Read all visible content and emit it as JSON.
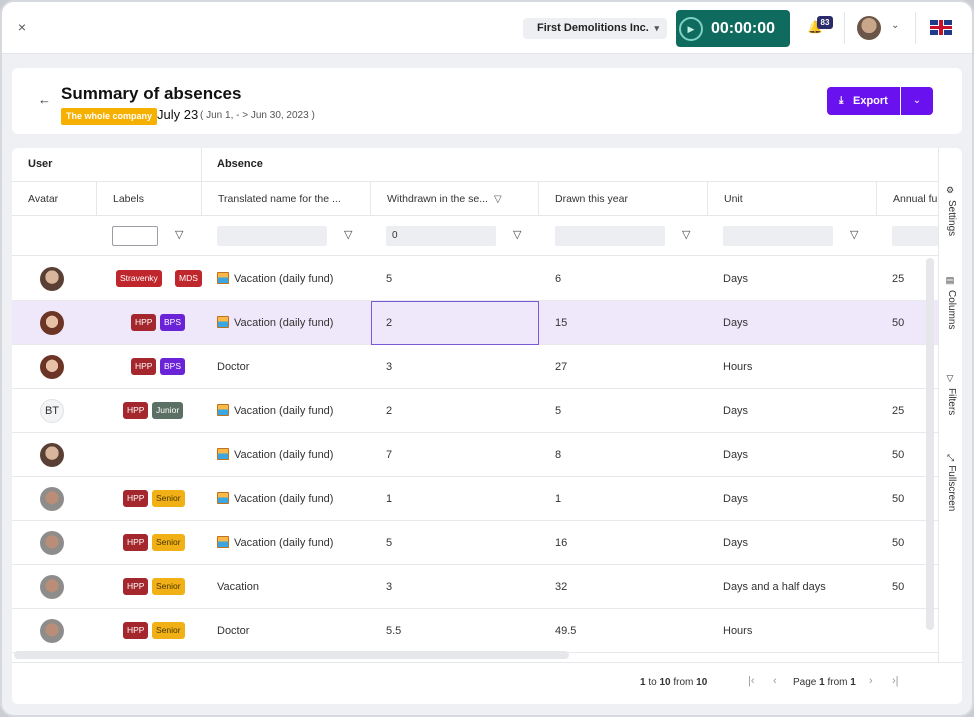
{
  "topbar": {
    "close_icon": "×",
    "company": "First Demolitions Inc.",
    "timer": "00:00:00",
    "notifications_count": "83"
  },
  "header": {
    "title": "Summary of absences",
    "scope_badge": "The whole company",
    "period": "July 23",
    "period_range": "( Jun 1, - > Jun 30, 2023 )",
    "export_label": "Export"
  },
  "table": {
    "group_user": "User",
    "group_absence": "Absence",
    "columns": {
      "avatar": "Avatar",
      "labels": "Labels",
      "name": "Translated name for the ...",
      "withdrawn": "Withdrawn in the se...",
      "drawn": "Drawn this year",
      "unit": "Unit",
      "annual": "Annual fu"
    },
    "filter_withdrawn": "0",
    "rows": [
      {
        "avatar": "photo",
        "tags": [
          {
            "t": "Stravenky",
            "c": "#c0272d"
          },
          {
            "t": "MDS",
            "c": "#c0272d"
          }
        ],
        "name": "Vacation (daily fund)",
        "icon": true,
        "withdrawn": "5",
        "drawn": "6",
        "unit": "Days",
        "annual": "25"
      },
      {
        "avatar": "photo-f",
        "tags": [
          {
            "t": "HPP",
            "c": "#a3272c"
          },
          {
            "t": "BPS",
            "c": "#6a23d6"
          }
        ],
        "name": "Vacation (daily fund)",
        "icon": true,
        "withdrawn": "2",
        "drawn": "15",
        "unit": "Days",
        "annual": "50"
      },
      {
        "avatar": "photo-f",
        "tags": [
          {
            "t": "HPP",
            "c": "#a3272c"
          },
          {
            "t": "BPS",
            "c": "#6a23d6"
          }
        ],
        "name": "Doctor",
        "icon": false,
        "withdrawn": "3",
        "drawn": "27",
        "unit": "Hours",
        "annual": ""
      },
      {
        "avatar": "BT",
        "tags": [
          {
            "t": "HPP",
            "c": "#a3272c"
          },
          {
            "t": "Junior",
            "c": "#5b6f64"
          }
        ],
        "name": "Vacation (daily fund)",
        "icon": true,
        "withdrawn": "2",
        "drawn": "5",
        "unit": "Days",
        "annual": "25"
      },
      {
        "avatar": "photo",
        "tags": [],
        "name": "Vacation (daily fund)",
        "icon": true,
        "withdrawn": "7",
        "drawn": "8",
        "unit": "Days",
        "annual": "50"
      },
      {
        "avatar": "photo-m",
        "tags": [
          {
            "t": "HPP",
            "c": "#a3272c"
          },
          {
            "t": "Senior",
            "c": "#f1b116"
          }
        ],
        "name": "Vacation (daily fund)",
        "icon": true,
        "withdrawn": "1",
        "drawn": "1",
        "unit": "Days",
        "annual": "50"
      },
      {
        "avatar": "photo-m",
        "tags": [
          {
            "t": "HPP",
            "c": "#a3272c"
          },
          {
            "t": "Senior",
            "c": "#f1b116"
          }
        ],
        "name": "Vacation (daily fund)",
        "icon": true,
        "withdrawn": "5",
        "drawn": "16",
        "unit": "Days",
        "annual": "50"
      },
      {
        "avatar": "photo-m",
        "tags": [
          {
            "t": "HPP",
            "c": "#a3272c"
          },
          {
            "t": "Senior",
            "c": "#f1b116"
          }
        ],
        "name": "Vacation",
        "icon": false,
        "withdrawn": "3",
        "drawn": "32",
        "unit": "Days and a half days",
        "annual": "50"
      },
      {
        "avatar": "photo-m",
        "tags": [
          {
            "t": "HPP",
            "c": "#a3272c"
          },
          {
            "t": "Senior",
            "c": "#f1b116"
          }
        ],
        "name": "Doctor",
        "icon": false,
        "withdrawn": "5.5",
        "drawn": "49.5",
        "unit": "Hours",
        "annual": ""
      }
    ]
  },
  "side_panel": {
    "settings": "Settings",
    "columns": "Columns",
    "filters": "Filters",
    "fullscreen": "Fullscreen"
  },
  "footer": {
    "range_from": "1",
    "range_to_word": "to",
    "range_to": "10",
    "range_of_word": "from",
    "range_total": "10",
    "page_word": "Page",
    "page_current": "1",
    "page_of_word": "from",
    "page_total": "1"
  },
  "colors": {
    "accent": "#6a11f0",
    "timer": "#0f6b5e",
    "selected_row": "#efe8fb",
    "scope_badge": "#f6b000"
  }
}
